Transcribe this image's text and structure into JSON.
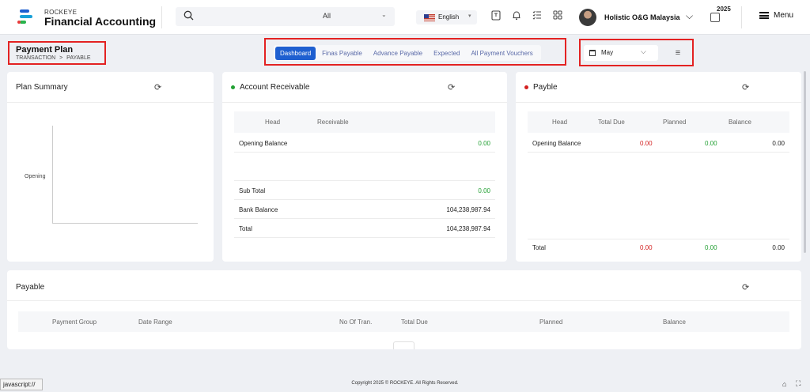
{
  "brand": {
    "company_small": "ROCKEYE",
    "app_name": "Financial Accounting"
  },
  "search": {
    "scope": "All"
  },
  "language": {
    "label": "English"
  },
  "user": {
    "company": "Holistic O&G Malaysia"
  },
  "year": "2025",
  "menu_label": "Menu",
  "page": {
    "title": "Payment Plan",
    "breadcrumb": [
      "TRANSACTION",
      ">",
      "PAYABLE"
    ]
  },
  "tabs": [
    "Dashboard",
    "Finas Payable",
    "Advance Payable",
    "Expected",
    "All Payment Vouchers"
  ],
  "filter": {
    "month": "May"
  },
  "plan_summary": {
    "title": "Plan Summary",
    "axis_label": "Opening"
  },
  "account_receivable": {
    "title": "Account Receivable",
    "headers": [
      "Head",
      "Receivable"
    ],
    "opening_label": "Opening Balance",
    "opening_value": "0.00",
    "rows": [
      {
        "label": "Sub Total",
        "value": "0.00"
      },
      {
        "label": "Bank Balance",
        "value": "104,238,987.94"
      },
      {
        "label": "Total",
        "value": "104,238,987.94"
      }
    ]
  },
  "payble": {
    "title": "Payble",
    "headers": [
      "Head",
      "Total Due",
      "Planned",
      "Balance"
    ],
    "opening": {
      "label": "Opening Balance",
      "total_due": "0.00",
      "planned": "0.00",
      "balance": "0.00"
    },
    "total": {
      "label": "Total",
      "total_due": "0.00",
      "planned": "0.00",
      "balance": "0.00"
    }
  },
  "payable": {
    "title": "Payable",
    "headers": [
      "Payment Group",
      "Date Range",
      "No Of Tran.",
      "Total Due",
      "Planned",
      "Balance"
    ]
  },
  "status_bar": {
    "url": "javascript://"
  },
  "footer": {
    "copyright": "Copyright 2025 © ROCKEYE. All Rights Reserved."
  },
  "colors": {
    "accent": "#1e5fd0",
    "negative": "#d32020",
    "positive": "#22a033",
    "highlight_box": "#e32222"
  }
}
